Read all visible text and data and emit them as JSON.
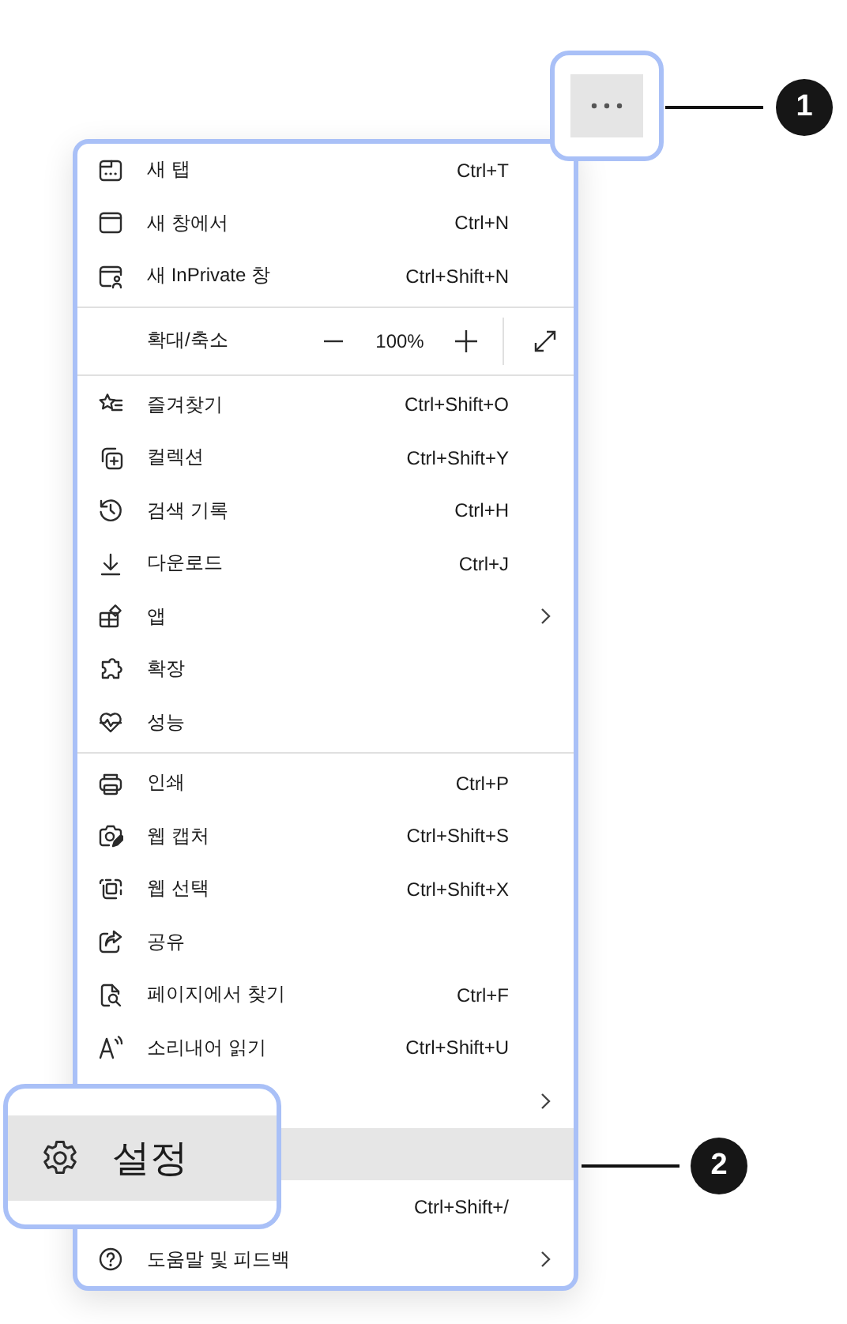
{
  "more_callout": {
    "number": "1"
  },
  "menu": {
    "items": [
      {
        "kind": "item",
        "label": "새 탭",
        "shortcut": "Ctrl+T",
        "has_submenu": false,
        "selected": false
      },
      {
        "kind": "item",
        "label": "새 창에서",
        "shortcut": "Ctrl+N",
        "has_submenu": false,
        "selected": false
      },
      {
        "kind": "item",
        "label": "새 InPrivate 창",
        "shortcut": "Ctrl+Shift+N",
        "has_submenu": false,
        "selected": false
      },
      {
        "kind": "divider"
      },
      {
        "kind": "zoom",
        "label": "확대/축소",
        "value": "100%"
      },
      {
        "kind": "divider"
      },
      {
        "kind": "item",
        "label": "즐겨찾기",
        "shortcut": "Ctrl+Shift+O",
        "has_submenu": false,
        "selected": false
      },
      {
        "kind": "item",
        "label": "컬렉션",
        "shortcut": "Ctrl+Shift+Y",
        "has_submenu": false,
        "selected": false
      },
      {
        "kind": "item",
        "label": "검색 기록",
        "shortcut": "Ctrl+H",
        "has_submenu": false,
        "selected": false
      },
      {
        "kind": "item",
        "label": "다운로드",
        "shortcut": "Ctrl+J",
        "has_submenu": false,
        "selected": false
      },
      {
        "kind": "item",
        "label": "앱",
        "has_submenu": true,
        "selected": false
      },
      {
        "kind": "item",
        "label": "확장",
        "has_submenu": false,
        "selected": false
      },
      {
        "kind": "item",
        "label": "성능",
        "has_submenu": false,
        "selected": false
      },
      {
        "kind": "divider"
      },
      {
        "kind": "item",
        "label": "인쇄",
        "shortcut": "Ctrl+P",
        "has_submenu": false,
        "selected": false
      },
      {
        "kind": "item",
        "label": "웹 캡처",
        "shortcut": "Ctrl+Shift+S",
        "has_submenu": false,
        "selected": false
      },
      {
        "kind": "item",
        "label": "웹 선택",
        "shortcut": "Ctrl+Shift+X",
        "has_submenu": false,
        "selected": false
      },
      {
        "kind": "item",
        "label": "공유",
        "has_submenu": false,
        "selected": false
      },
      {
        "kind": "item",
        "label": "페이지에서 찾기",
        "shortcut": "Ctrl+F",
        "has_submenu": false,
        "selected": false
      },
      {
        "kind": "item",
        "label": "소리내어 읽기",
        "shortcut": "Ctrl+Shift+U",
        "has_submenu": false,
        "selected": false
      },
      {
        "kind": "item",
        "has_submenu": true,
        "selected": false
      },
      {
        "kind": "item",
        "has_submenu": false,
        "selected": true
      },
      {
        "kind": "item",
        "shortcut": "Ctrl+Shift+/",
        "has_submenu": false,
        "selected": false
      },
      {
        "kind": "item",
        "label": "도움말 및 피드백",
        "has_submenu": true,
        "selected": false
      }
    ]
  },
  "settings_callout": {
    "label": "설정",
    "selected": true,
    "number": "2"
  }
}
